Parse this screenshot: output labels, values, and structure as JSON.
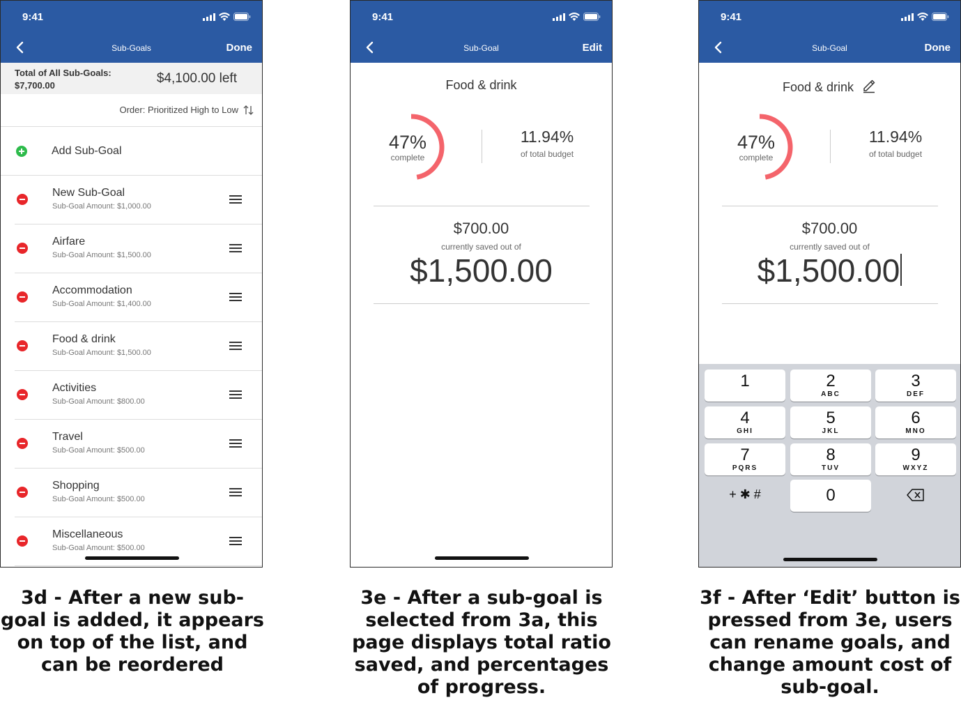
{
  "status": {
    "time": "9:41"
  },
  "screen_3d": {
    "nav": {
      "title": "Sub-Goals",
      "action": "Done"
    },
    "summary": {
      "label_line1": "Total of All Sub-Goals:",
      "label_line2": "$7,700.00",
      "left": "$4,100.00 left"
    },
    "order": "Order: Prioritized High to Low",
    "add_label": "Add Sub-Goal",
    "items": [
      {
        "name": "New Sub-Goal",
        "amount": "Sub-Goal Amount: $1,000.00"
      },
      {
        "name": "Airfare",
        "amount": "Sub-Goal Amount: $1,500.00"
      },
      {
        "name": "Accommodation",
        "amount": "Sub-Goal Amount: $1,400.00"
      },
      {
        "name": "Food & drink",
        "amount": "Sub-Goal Amount: $1,500.00"
      },
      {
        "name": "Activities",
        "amount": "Sub-Goal Amount: $800.00"
      },
      {
        "name": "Travel",
        "amount": "Sub-Goal Amount: $500.00"
      },
      {
        "name": "Shopping",
        "amount": "Sub-Goal Amount: $500.00"
      },
      {
        "name": "Miscellaneous",
        "amount": "Sub-Goal Amount: $500.00"
      }
    ]
  },
  "screen_3e": {
    "nav": {
      "title": "Sub-Goal",
      "action": "Edit"
    },
    "goal_name": "Food & drink",
    "percent": "47%",
    "percent_label": "complete",
    "percent_value": 0.47,
    "share": "11.94%",
    "share_label": "of total budget",
    "saved": "$700.00",
    "saved_label": "currently saved out of",
    "target": "$1,500.00"
  },
  "screen_3f": {
    "nav": {
      "title": "Sub-Goal",
      "action": "Done"
    },
    "goal_name": "Food & drink",
    "percent": "47%",
    "percent_label": "complete",
    "percent_value": 0.47,
    "share": "11.94%",
    "share_label": "of total budget",
    "saved": "$700.00",
    "saved_label": "currently saved out of",
    "target": "$1,500.00",
    "keypad": [
      {
        "num": "1",
        "letters": ""
      },
      {
        "num": "2",
        "letters": "ABC"
      },
      {
        "num": "3",
        "letters": "DEF"
      },
      {
        "num": "4",
        "letters": "GHI"
      },
      {
        "num": "5",
        "letters": "JKL"
      },
      {
        "num": "6",
        "letters": "MNO"
      },
      {
        "num": "7",
        "letters": "PQRS"
      },
      {
        "num": "8",
        "letters": "TUV"
      },
      {
        "num": "9",
        "letters": "WXYZ"
      },
      {
        "num": "0",
        "letters": ""
      }
    ],
    "symbols_key": "+ ✱ #"
  },
  "captions": {
    "c3d": "3d - After a new sub-goal is added, it appears on top of the list, and can be reordered",
    "c3e": "3e - After a sub-goal is selected from 3a, this page displays total ratio saved, and percentages of progress.",
    "c3f": "3f - After ‘Edit’ button is pressed from 3e, users can rename goals, and change amount cost of sub-goal."
  },
  "colors": {
    "nav": "#2b5aa3",
    "progress": "#f4646b",
    "add": "#2dbb4b",
    "remove": "#e8262a"
  }
}
